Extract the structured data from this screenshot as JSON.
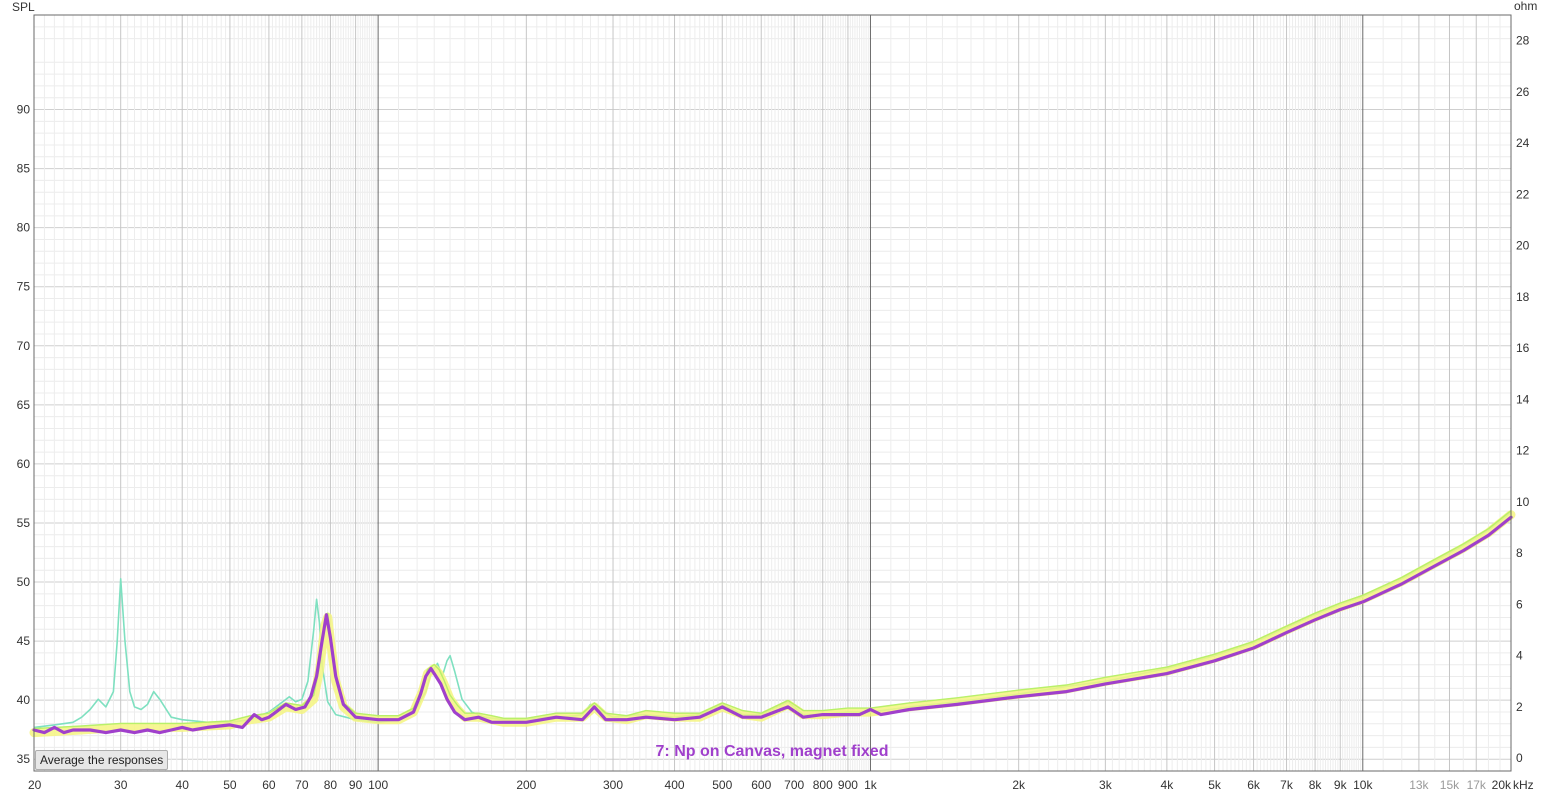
{
  "avg_button_label": "Average the responses",
  "chart_data": {
    "type": "line",
    "title": "",
    "xlabel": "kHz",
    "ylabel_left": "SPL",
    "ylabel_right": "ohm",
    "x_scale": "log",
    "xlim": [
      20,
      20000
    ],
    "ylim_left": [
      34,
      98
    ],
    "ylim_right": [
      -0.5,
      29
    ],
    "grid": true,
    "y_ticks_left": [
      35,
      40,
      45,
      50,
      55,
      60,
      65,
      70,
      75,
      80,
      85,
      90
    ],
    "y_ticks_right": [
      0,
      2,
      4,
      6,
      8,
      10,
      12,
      14,
      16,
      18,
      20,
      22,
      24,
      26,
      28
    ],
    "x_ticks": [
      {
        "value": 20,
        "label": "20"
      },
      {
        "value": 30,
        "label": "30"
      },
      {
        "value": 40,
        "label": "40"
      },
      {
        "value": 50,
        "label": "50"
      },
      {
        "value": 60,
        "label": "60"
      },
      {
        "value": 70,
        "label": "70"
      },
      {
        "value": 80,
        "label": "80"
      },
      {
        "value": 90,
        "label": "90"
      },
      {
        "value": 100,
        "label": "100"
      },
      {
        "value": 200,
        "label": "200"
      },
      {
        "value": 300,
        "label": "300"
      },
      {
        "value": 400,
        "label": "400"
      },
      {
        "value": 500,
        "label": "500"
      },
      {
        "value": 600,
        "label": "600"
      },
      {
        "value": 700,
        "label": "700"
      },
      {
        "value": 800,
        "label": "800"
      },
      {
        "value": 900,
        "label": "900"
      },
      {
        "value": 1000,
        "label": "1k"
      },
      {
        "value": 2000,
        "label": "2k"
      },
      {
        "value": 3000,
        "label": "3k"
      },
      {
        "value": 4000,
        "label": "4k"
      },
      {
        "value": 5000,
        "label": "5k"
      },
      {
        "value": 6000,
        "label": "6k"
      },
      {
        "value": 7000,
        "label": "7k"
      },
      {
        "value": 8000,
        "label": "8k"
      },
      {
        "value": 9000,
        "label": "9k"
      },
      {
        "value": 10000,
        "label": "10k"
      },
      {
        "value": 13000,
        "label": "13k",
        "faint": true
      },
      {
        "value": 15000,
        "label": "15k",
        "faint": true
      },
      {
        "value": 17000,
        "label": "17k",
        "faint": true
      },
      {
        "value": 20000,
        "label": "20k"
      }
    ],
    "annotations": [
      {
        "text": "7: Np on Canvas, magnet fixed",
        "color": "#a040cc"
      }
    ],
    "series": [
      {
        "color": "#7ee0c0",
        "axis": "right",
        "points": [
          [
            20,
            1.2
          ],
          [
            22,
            1.3
          ],
          [
            24,
            1.4
          ],
          [
            25,
            1.6
          ],
          [
            26,
            1.9
          ],
          [
            27,
            2.3
          ],
          [
            28,
            2.0
          ],
          [
            29,
            2.6
          ],
          [
            29.5,
            4.5
          ],
          [
            30,
            7.0
          ],
          [
            30.6,
            4.6
          ],
          [
            31.3,
            2.6
          ],
          [
            32,
            2.0
          ],
          [
            33,
            1.9
          ],
          [
            34,
            2.1
          ],
          [
            35,
            2.6
          ],
          [
            36,
            2.3
          ],
          [
            38,
            1.6
          ],
          [
            40,
            1.5
          ],
          [
            45,
            1.4
          ],
          [
            50,
            1.4
          ],
          [
            55,
            1.5
          ],
          [
            60,
            1.8
          ],
          [
            64,
            2.2
          ],
          [
            66,
            2.4
          ],
          [
            68,
            2.2
          ],
          [
            70,
            2.3
          ],
          [
            72,
            3.0
          ],
          [
            74,
            5.0
          ],
          [
            75,
            6.2
          ],
          [
            76,
            5.3
          ],
          [
            77,
            3.6
          ],
          [
            79,
            2.2
          ],
          [
            82,
            1.7
          ],
          [
            90,
            1.5
          ],
          [
            100,
            1.4
          ],
          [
            110,
            1.5
          ],
          [
            120,
            2.0
          ],
          [
            125,
            2.6
          ],
          [
            128,
            3.3
          ],
          [
            132,
            3.7
          ],
          [
            135,
            3.2
          ],
          [
            138,
            3.8
          ],
          [
            140,
            4.0
          ],
          [
            143,
            3.4
          ],
          [
            148,
            2.3
          ],
          [
            155,
            1.8
          ],
          [
            165,
            1.6
          ],
          [
            180,
            1.5
          ],
          [
            200,
            1.5
          ],
          [
            220,
            1.6
          ],
          [
            240,
            1.6
          ],
          [
            260,
            1.7
          ],
          [
            270,
            2.1
          ],
          [
            280,
            1.9
          ],
          [
            300,
            1.6
          ],
          [
            340,
            1.7
          ],
          [
            400,
            1.6
          ],
          [
            450,
            1.7
          ],
          [
            500,
            2.1
          ],
          [
            550,
            1.7
          ],
          [
            600,
            1.7
          ],
          [
            680,
            2.2
          ],
          [
            730,
            1.7
          ],
          [
            800,
            1.7
          ],
          [
            900,
            1.8
          ],
          [
            1000,
            1.8
          ],
          [
            1200,
            2.0
          ],
          [
            1500,
            2.2
          ],
          [
            2000,
            2.5
          ],
          [
            2500,
            2.8
          ],
          [
            3000,
            3.0
          ],
          [
            4000,
            3.5
          ],
          [
            5000,
            4.0
          ],
          [
            6000,
            4.5
          ],
          [
            7000,
            5.1
          ],
          [
            8000,
            5.6
          ],
          [
            9000,
            6.0
          ],
          [
            10000,
            6.3
          ],
          [
            12000,
            7.0
          ],
          [
            14000,
            7.7
          ],
          [
            16000,
            8.3
          ],
          [
            18000,
            8.9
          ],
          [
            20000,
            9.6
          ]
        ]
      },
      {
        "color": "#f4f480",
        "axis": "right",
        "points": [
          [
            20,
            1.0
          ],
          [
            25,
            1.1
          ],
          [
            30,
            1.2
          ],
          [
            40,
            1.2
          ],
          [
            50,
            1.3
          ],
          [
            55,
            1.5
          ],
          [
            60,
            1.6
          ],
          [
            65,
            2.0
          ],
          [
            70,
            1.9
          ],
          [
            74,
            2.3
          ],
          [
            76,
            3.4
          ],
          [
            78,
            5.2
          ],
          [
            79,
            5.5
          ],
          [
            80,
            4.6
          ],
          [
            82,
            3.0
          ],
          [
            85,
            2.0
          ],
          [
            90,
            1.6
          ],
          [
            100,
            1.5
          ],
          [
            110,
            1.5
          ],
          [
            118,
            1.8
          ],
          [
            123,
            2.6
          ],
          [
            126,
            3.3
          ],
          [
            130,
            3.5
          ],
          [
            133,
            3.3
          ],
          [
            136,
            2.9
          ],
          [
            140,
            2.3
          ],
          [
            145,
            1.9
          ],
          [
            150,
            1.6
          ],
          [
            160,
            1.6
          ],
          [
            170,
            1.5
          ],
          [
            180,
            1.4
          ],
          [
            200,
            1.4
          ],
          [
            230,
            1.6
          ],
          [
            260,
            1.6
          ],
          [
            275,
            2.0
          ],
          [
            290,
            1.6
          ],
          [
            320,
            1.5
          ],
          [
            350,
            1.7
          ],
          [
            400,
            1.6
          ],
          [
            450,
            1.6
          ],
          [
            500,
            2.0
          ],
          [
            550,
            1.7
          ],
          [
            600,
            1.6
          ],
          [
            680,
            2.1
          ],
          [
            730,
            1.7
          ],
          [
            800,
            1.7
          ],
          [
            900,
            1.8
          ],
          [
            1000,
            1.8
          ],
          [
            1200,
            2.0
          ],
          [
            1500,
            2.2
          ],
          [
            2000,
            2.5
          ],
          [
            2500,
            2.7
          ],
          [
            3000,
            3.0
          ],
          [
            4000,
            3.4
          ],
          [
            5000,
            3.9
          ],
          [
            6000,
            4.4
          ],
          [
            7000,
            5.0
          ],
          [
            8000,
            5.5
          ],
          [
            9000,
            5.9
          ],
          [
            10000,
            6.2
          ],
          [
            12000,
            6.9
          ],
          [
            14000,
            7.6
          ],
          [
            16000,
            8.2
          ],
          [
            18000,
            8.8
          ],
          [
            20000,
            9.5
          ]
        ]
      },
      {
        "color": "#a040cc",
        "axis": "right",
        "points": [
          [
            20,
            1.1
          ],
          [
            21,
            1.0
          ],
          [
            22,
            1.2
          ],
          [
            23,
            1.0
          ],
          [
            24,
            1.1
          ],
          [
            26,
            1.1
          ],
          [
            28,
            1.0
          ],
          [
            30,
            1.1
          ],
          [
            32,
            1.0
          ],
          [
            34,
            1.1
          ],
          [
            36,
            1.0
          ],
          [
            38,
            1.1
          ],
          [
            40,
            1.2
          ],
          [
            42,
            1.1
          ],
          [
            45,
            1.2
          ],
          [
            50,
            1.3
          ],
          [
            53,
            1.2
          ],
          [
            56,
            1.7
          ],
          [
            58,
            1.5
          ],
          [
            60,
            1.6
          ],
          [
            62,
            1.8
          ],
          [
            65,
            2.1
          ],
          [
            68,
            1.9
          ],
          [
            71,
            2.0
          ],
          [
            73,
            2.4
          ],
          [
            75,
            3.2
          ],
          [
            77,
            4.6
          ],
          [
            78.5,
            5.6
          ],
          [
            80,
            4.7
          ],
          [
            82,
            3.2
          ],
          [
            85,
            2.1
          ],
          [
            90,
            1.6
          ],
          [
            100,
            1.5
          ],
          [
            110,
            1.5
          ],
          [
            118,
            1.8
          ],
          [
            122,
            2.5
          ],
          [
            125,
            3.2
          ],
          [
            128,
            3.5
          ],
          [
            131,
            3.2
          ],
          [
            134,
            2.9
          ],
          [
            138,
            2.3
          ],
          [
            143,
            1.8
          ],
          [
            150,
            1.5
          ],
          [
            160,
            1.6
          ],
          [
            170,
            1.4
          ],
          [
            180,
            1.4
          ],
          [
            200,
            1.4
          ],
          [
            230,
            1.6
          ],
          [
            260,
            1.5
          ],
          [
            275,
            2.0
          ],
          [
            290,
            1.5
          ],
          [
            320,
            1.5
          ],
          [
            350,
            1.6
          ],
          [
            400,
            1.5
          ],
          [
            450,
            1.6
          ],
          [
            500,
            2.0
          ],
          [
            550,
            1.6
          ],
          [
            600,
            1.6
          ],
          [
            680,
            2.0
          ],
          [
            730,
            1.6
          ],
          [
            800,
            1.7
          ],
          [
            900,
            1.7
          ],
          [
            950,
            1.7
          ],
          [
            1000,
            1.9
          ],
          [
            1050,
            1.7
          ],
          [
            1200,
            1.9
          ],
          [
            1500,
            2.1
          ],
          [
            2000,
            2.4
          ],
          [
            2500,
            2.6
          ],
          [
            3000,
            2.9
          ],
          [
            4000,
            3.3
          ],
          [
            5000,
            3.8
          ],
          [
            6000,
            4.3
          ],
          [
            7000,
            4.9
          ],
          [
            8000,
            5.4
          ],
          [
            9000,
            5.8
          ],
          [
            10000,
            6.1
          ],
          [
            12000,
            6.8
          ],
          [
            14000,
            7.5
          ],
          [
            16000,
            8.1
          ],
          [
            18000,
            8.7
          ],
          [
            20000,
            9.4
          ]
        ]
      }
    ]
  }
}
